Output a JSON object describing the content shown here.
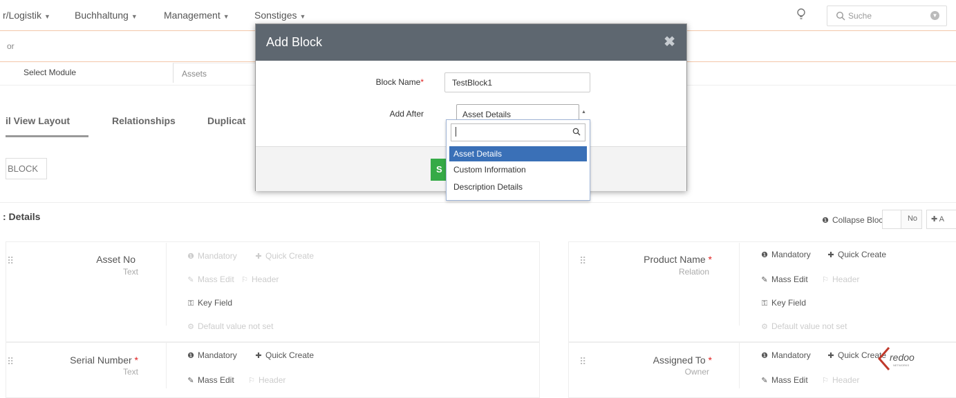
{
  "nav": {
    "items": [
      "r/Logistik",
      "Buchhaltung",
      "Management",
      "Sonstiges"
    ],
    "search_placeholder": "Suche"
  },
  "breadcrumb": "or",
  "module_select": {
    "label": "Select Module",
    "value": "Assets"
  },
  "tabs": [
    "il View Layout",
    "Relationships",
    "Duplicat"
  ],
  "add_block_button": "BLOCK",
  "block": {
    "title": ": Details",
    "collapse_label": "Collapse Block",
    "collapse_value": "No",
    "add_field_label": "A"
  },
  "props": {
    "mandatory": "Mandatory",
    "quick_create": "Quick Create",
    "mass_edit": "Mass Edit",
    "header": "Header",
    "key_field": "Key Field",
    "default_value": "Default value not set"
  },
  "fields": [
    {
      "name": "Asset No",
      "type": "Text",
      "required": false
    },
    {
      "name": "Product Name",
      "type": "Relation",
      "required": true
    },
    {
      "name": "Serial Number",
      "type": "Text",
      "required": true
    },
    {
      "name": "Assigned To",
      "type": "Owner",
      "required": true
    }
  ],
  "modal": {
    "title": "Add Block",
    "close_glyph": "✖",
    "block_name_label": "Block Name",
    "required_mark": "*",
    "block_name_value": "TestBlock1",
    "add_after_label": "Add After",
    "add_after_value": "Asset Details",
    "save_label": "S"
  },
  "dropdown": {
    "options": [
      "Asset Details",
      "Custom Information",
      "Description Details"
    ],
    "selected_index": 0
  },
  "logo": {
    "text": "redoo",
    "subtext": "NETWORKS"
  },
  "colors": {
    "modal_header": "#5e6770",
    "selected_option": "#3a70b7",
    "save_button": "#35aa47",
    "required": "#e02020",
    "logo": "#c0392b"
  }
}
